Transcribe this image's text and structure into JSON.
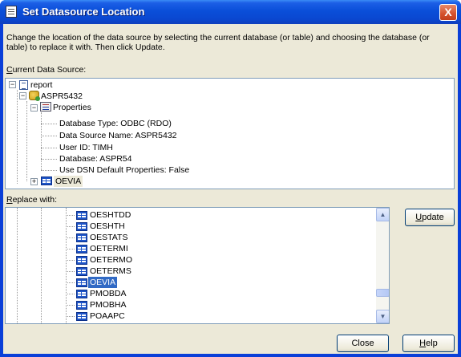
{
  "window": {
    "title": "Set Datasource Location",
    "close_glyph": "X"
  },
  "dialog": {
    "description": "Change the location of the data source by selecting the current database (or table) and choosing the database (or table) to replace it with.  Then click Update.",
    "current_label_access": "C",
    "current_label_rest": "urrent Data Source:",
    "replace_label_access": "R",
    "replace_label_rest": "eplace with:"
  },
  "current_tree": {
    "report": "report",
    "connection": "ASPR5432",
    "properties": "Properties",
    "props": [
      "Database Type: ODBC (RDO)",
      "Data Source Name: ASPR5432",
      "User ID: TIMH",
      "Database: ASPR54",
      "Use DSN Default Properties: False"
    ],
    "table": "OEVIA"
  },
  "replace_list": {
    "items": [
      "OESHTDD",
      "OESHTH",
      "OESTATS",
      "OETERMI",
      "OETERMO",
      "OETERMS",
      "OEVIA",
      "PMOBDA",
      "PMOBHA",
      "POAAPC"
    ],
    "selected": "OEVIA"
  },
  "buttons": {
    "update_access": "U",
    "update_rest": "pdate",
    "close": "Close",
    "help_access": "H",
    "help_rest": "elp"
  },
  "icons": {
    "title": "document-icon",
    "report": "report-icon",
    "connection": "database-icon",
    "properties": "properties-icon",
    "table": "table-icon"
  },
  "colors": {
    "titlebar": "#0a4fd9",
    "selection": "#316ac5",
    "face": "#ece9d8"
  }
}
